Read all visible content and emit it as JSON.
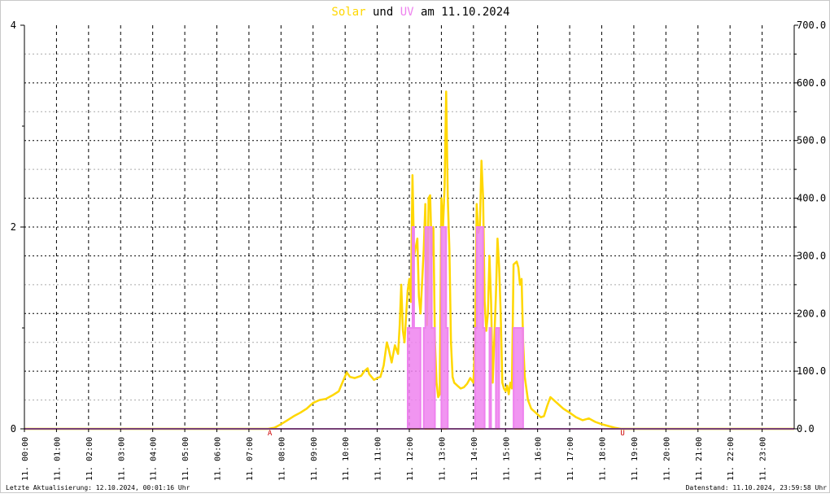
{
  "title": {
    "part1": "Solar",
    "part2": " und ",
    "part3": "UV",
    "part4": " am 11.10.2024"
  },
  "footer": {
    "left": "Letzte Aktualisierung: 12.10.2024, 00:01:16 Uhr",
    "right": "Datenstand: 11.10.2024, 23:59:58 Uhr"
  },
  "markers": {
    "sunrise": "A",
    "sunset": "U",
    "sunrise_time": 7.65,
    "sunset_time": 18.65
  },
  "colors": {
    "solar": "#ffd700",
    "uv": "#ee82ee",
    "baseline": "#fa8072",
    "marker": "#cc0000",
    "grid": "#000000"
  },
  "chart_data": {
    "type": "line",
    "title": "Solar und UV am 11.10.2024",
    "x_range": [
      0,
      24
    ],
    "x_tick_labels": [
      "11. 00:00",
      "11. 01:00",
      "11. 02:00",
      "11. 03:00",
      "11. 04:00",
      "11. 05:00",
      "11. 06:00",
      "11. 07:00",
      "11. 08:00",
      "11. 09:00",
      "11. 10:00",
      "11. 11:00",
      "11. 12:00",
      "11. 13:00",
      "11. 14:00",
      "11. 15:00",
      "11. 16:00",
      "11. 17:00",
      "11. 18:00",
      "11. 19:00",
      "11. 20:00",
      "11. 21:00",
      "11. 22:00",
      "11. 23:00"
    ],
    "y_left": {
      "range": [
        0,
        4
      ],
      "tick_labels": [
        "0",
        "2",
        "4"
      ]
    },
    "y_right": {
      "range": [
        0,
        700
      ],
      "tick_labels": [
        "0.0",
        "100.0",
        "200.0",
        "300.0",
        "400.0",
        "500.0",
        "600.0",
        "700.0"
      ]
    },
    "grid": true,
    "series": [
      {
        "name": "Solar",
        "axis": "right",
        "points": [
          [
            0,
            0
          ],
          [
            7.6,
            0
          ],
          [
            7.8,
            2
          ],
          [
            8.0,
            8
          ],
          [
            8.2,
            15
          ],
          [
            8.4,
            22
          ],
          [
            8.6,
            28
          ],
          [
            8.8,
            35
          ],
          [
            9.0,
            45
          ],
          [
            9.2,
            50
          ],
          [
            9.4,
            52
          ],
          [
            9.6,
            58
          ],
          [
            9.8,
            65
          ],
          [
            9.95,
            85
          ],
          [
            10.05,
            98
          ],
          [
            10.15,
            90
          ],
          [
            10.3,
            88
          ],
          [
            10.5,
            92
          ],
          [
            10.6,
            100
          ],
          [
            10.7,
            105
          ],
          [
            10.75,
            95
          ],
          [
            10.9,
            85
          ],
          [
            11.0,
            88
          ],
          [
            11.1,
            90
          ],
          [
            11.2,
            110
          ],
          [
            11.3,
            150
          ],
          [
            11.35,
            140
          ],
          [
            11.45,
            115
          ],
          [
            11.55,
            145
          ],
          [
            11.65,
            130
          ],
          [
            11.7,
            180
          ],
          [
            11.75,
            250
          ],
          [
            11.8,
            170
          ],
          [
            11.85,
            150
          ],
          [
            11.95,
            240
          ],
          [
            12.0,
            260
          ],
          [
            12.05,
            220
          ],
          [
            12.1,
            440
          ],
          [
            12.15,
            300
          ],
          [
            12.25,
            330
          ],
          [
            12.3,
            230
          ],
          [
            12.35,
            200
          ],
          [
            12.45,
            310
          ],
          [
            12.5,
            390
          ],
          [
            12.55,
            180
          ],
          [
            12.6,
            400
          ],
          [
            12.65,
            405
          ],
          [
            12.7,
            300
          ],
          [
            12.75,
            350
          ],
          [
            12.8,
            150
          ],
          [
            12.85,
            80
          ],
          [
            12.9,
            55
          ],
          [
            12.95,
            60
          ],
          [
            13.0,
            400
          ],
          [
            13.05,
            350
          ],
          [
            13.1,
            420
          ],
          [
            13.15,
            585
          ],
          [
            13.2,
            400
          ],
          [
            13.25,
            310
          ],
          [
            13.3,
            150
          ],
          [
            13.35,
            90
          ],
          [
            13.4,
            80
          ],
          [
            13.5,
            75
          ],
          [
            13.6,
            70
          ],
          [
            13.7,
            72
          ],
          [
            13.8,
            78
          ],
          [
            13.9,
            88
          ],
          [
            14.0,
            80
          ],
          [
            14.05,
            150
          ],
          [
            14.1,
            390
          ],
          [
            14.15,
            340
          ],
          [
            14.2,
            350
          ],
          [
            14.25,
            465
          ],
          [
            14.3,
            400
          ],
          [
            14.35,
            220
          ],
          [
            14.4,
            170
          ],
          [
            14.45,
            200
          ],
          [
            14.5,
            300
          ],
          [
            14.55,
            220
          ],
          [
            14.6,
            80
          ],
          [
            14.7,
            230
          ],
          [
            14.75,
            330
          ],
          [
            14.8,
            280
          ],
          [
            14.85,
            200
          ],
          [
            14.9,
            80
          ],
          [
            14.95,
            70
          ],
          [
            15.0,
            65
          ],
          [
            15.05,
            75
          ],
          [
            15.1,
            60
          ],
          [
            15.15,
            80
          ],
          [
            15.2,
            70
          ],
          [
            15.25,
            285
          ],
          [
            15.35,
            290
          ],
          [
            15.4,
            280
          ],
          [
            15.45,
            250
          ],
          [
            15.5,
            260
          ],
          [
            15.55,
            150
          ],
          [
            15.6,
            90
          ],
          [
            15.7,
            50
          ],
          [
            15.8,
            35
          ],
          [
            15.9,
            30
          ],
          [
            16.0,
            25
          ],
          [
            16.1,
            20
          ],
          [
            16.2,
            22
          ],
          [
            16.3,
            40
          ],
          [
            16.4,
            55
          ],
          [
            16.5,
            50
          ],
          [
            16.6,
            45
          ],
          [
            16.8,
            35
          ],
          [
            17.0,
            28
          ],
          [
            17.2,
            20
          ],
          [
            17.4,
            15
          ],
          [
            17.6,
            18
          ],
          [
            17.8,
            12
          ],
          [
            18.0,
            8
          ],
          [
            18.2,
            5
          ],
          [
            18.4,
            2
          ],
          [
            18.6,
            0
          ],
          [
            24,
            0
          ]
        ]
      },
      {
        "name": "UV",
        "axis": "left",
        "points": [
          [
            0,
            0
          ],
          [
            11.95,
            0
          ],
          [
            11.95,
            1
          ],
          [
            12.1,
            1
          ],
          [
            12.1,
            2
          ],
          [
            12.15,
            2
          ],
          [
            12.15,
            1
          ],
          [
            12.35,
            1
          ],
          [
            12.35,
            0
          ],
          [
            12.45,
            0
          ],
          [
            12.45,
            1
          ],
          [
            12.5,
            1
          ],
          [
            12.5,
            2
          ],
          [
            12.7,
            2
          ],
          [
            12.7,
            1
          ],
          [
            12.8,
            1
          ],
          [
            12.8,
            0
          ],
          [
            13.0,
            0
          ],
          [
            13.0,
            2
          ],
          [
            13.15,
            2
          ],
          [
            13.15,
            1
          ],
          [
            13.2,
            1
          ],
          [
            13.2,
            0
          ],
          [
            14.05,
            0
          ],
          [
            14.05,
            1
          ],
          [
            14.1,
            1
          ],
          [
            14.1,
            2
          ],
          [
            14.3,
            2
          ],
          [
            14.3,
            1
          ],
          [
            14.35,
            1
          ],
          [
            14.35,
            0
          ],
          [
            14.5,
            0
          ],
          [
            14.5,
            1
          ],
          [
            14.55,
            1
          ],
          [
            14.55,
            0
          ],
          [
            14.7,
            0
          ],
          [
            14.7,
            1
          ],
          [
            14.8,
            1
          ],
          [
            14.8,
            0
          ],
          [
            15.25,
            0
          ],
          [
            15.25,
            1
          ],
          [
            15.55,
            1
          ],
          [
            15.55,
            0
          ],
          [
            24,
            0
          ]
        ]
      }
    ]
  }
}
